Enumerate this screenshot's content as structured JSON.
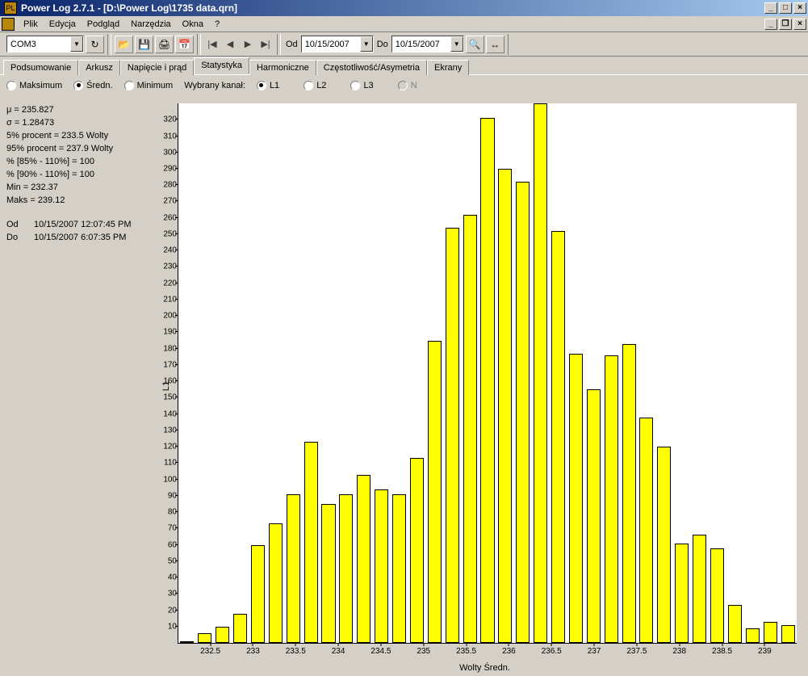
{
  "window": {
    "title": "Power Log 2.7.1 - [D:\\Power Log\\1735 data.qrn]"
  },
  "menu": {
    "items": [
      "Plik",
      "Edycja",
      "Podgląd",
      "Narzędzia",
      "Okna",
      "?"
    ]
  },
  "toolbar": {
    "port": "COM3",
    "port_dd_icon": "▼",
    "reload_icon": "↻",
    "open_icon": "📂",
    "save_icon": "💾",
    "print_icon": "🖨",
    "cal_icon": "📅",
    "nav_first": "|◀",
    "nav_prev": "◀",
    "nav_next": "▶",
    "nav_last": "▶|",
    "od_label": "Od",
    "do_label": "Do",
    "date_od": "10/15/2007",
    "date_do": "10/15/2007",
    "zoom_icon": "🔍",
    "range_icon": "↔"
  },
  "tabs": {
    "items": [
      "Podsumowanie",
      "Arkusz",
      "Napięcie i prąd",
      "Statystyka",
      "Harmoniczne",
      "Częstotliwość/Asymetria",
      "Ekrany"
    ],
    "active_index": 3
  },
  "sub": {
    "mode_labels": [
      "Maksimum",
      "Średn.",
      "Minimum"
    ],
    "mode_checked": 1,
    "channel_label": "Wybrany kanał:",
    "channel_labels": [
      "L1",
      "L2",
      "L3",
      "N"
    ],
    "channel_checked": 0,
    "channel_disabled": 3
  },
  "stats": {
    "mu": "μ = 235.827",
    "sigma": "σ = 1.28473",
    "p5": "5% procent = 233.5 Wolty",
    "p95": "95% procent = 237.9 Wolty",
    "pct85": "% [85% - 110%] = 100",
    "pct90": "% [90% - 110%] = 100",
    "min": "Min = 232.37",
    "max": "Maks = 239.12",
    "od_lbl": "Od",
    "od_val": "10/15/2007 12:07:45 PM",
    "do_lbl": "Do",
    "do_val": "10/15/2007 6:07:35 PM"
  },
  "chart_data": {
    "type": "bar",
    "ylabel": "L1",
    "xlabel": "Wolty Średn.",
    "ylim": [
      0,
      330
    ],
    "yticks": [
      10,
      20,
      30,
      40,
      50,
      60,
      70,
      80,
      90,
      100,
      110,
      120,
      130,
      140,
      150,
      160,
      170,
      180,
      190,
      200,
      210,
      220,
      230,
      240,
      250,
      260,
      270,
      280,
      290,
      300,
      310,
      320
    ],
    "xticks": [
      232.5,
      233,
      233.5,
      234,
      234.5,
      235,
      235.5,
      236,
      236.5,
      237,
      237.5,
      238,
      238.5,
      239
    ],
    "categories": [
      232.25,
      232.5,
      232.75,
      233,
      233.25,
      233.5,
      233.75,
      234,
      234.25,
      234.5,
      234.75,
      235,
      235.25,
      235.5,
      235.75,
      236,
      236.25,
      236.5,
      236.75,
      237,
      237.25,
      237.5,
      237.75,
      238,
      238.25,
      238.5,
      238.75,
      239,
      239.25
    ],
    "values": [
      1,
      6,
      10,
      18,
      60,
      73,
      91,
      123,
      85,
      91,
      103,
      94,
      91,
      113,
      185,
      254,
      262,
      321,
      290,
      282,
      330,
      252,
      177,
      155,
      176,
      183,
      138,
      120,
      61,
      66,
      58,
      23,
      9,
      13,
      11
    ]
  }
}
